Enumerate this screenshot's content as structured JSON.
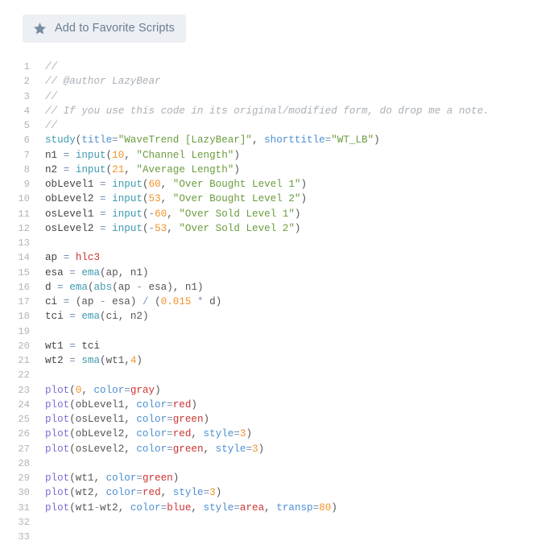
{
  "toolbar": {
    "favorite_button_label": "Add to Favorite Scripts",
    "favorite_icon": "star-icon"
  },
  "colors": {
    "button_bg": "#eceff3",
    "button_text": "#6d7d90",
    "page_bg": "#ffffff",
    "gutter_text": "#b4b4b4",
    "comment": "#a9b0b7",
    "function": "#3f9ab0",
    "plot_function": "#7b6fd4",
    "string": "#6a9c3d",
    "number": "#f0932b",
    "keyword": "#cc3333",
    "parameter": "#4b8fd1",
    "operator": "#7690b0",
    "default_text": "#444444"
  },
  "editor": {
    "first_line_number": 1,
    "last_line_number": 33,
    "language": "pine-script",
    "lines": [
      {
        "n": 1,
        "tokens": [
          {
            "t": "//",
            "c": "com"
          }
        ]
      },
      {
        "n": 2,
        "tokens": [
          {
            "t": "// @author LazyBear",
            "c": "com"
          }
        ]
      },
      {
        "n": 3,
        "tokens": [
          {
            "t": "//",
            "c": "com"
          }
        ]
      },
      {
        "n": 4,
        "tokens": [
          {
            "t": "// If you use this code in its original/modified form, do drop me a note.",
            "c": "com"
          }
        ]
      },
      {
        "n": 5,
        "tokens": [
          {
            "t": "//",
            "c": "com"
          }
        ]
      },
      {
        "n": 6,
        "tokens": [
          {
            "t": "study",
            "c": "fn"
          },
          {
            "t": "(",
            "c": "pn"
          },
          {
            "t": "title",
            "c": "param"
          },
          {
            "t": "=",
            "c": "op"
          },
          {
            "t": "\"WaveTrend [LazyBear]\"",
            "c": "str"
          },
          {
            "t": ", ",
            "c": "pn"
          },
          {
            "t": "shorttitle",
            "c": "param"
          },
          {
            "t": "=",
            "c": "op"
          },
          {
            "t": "\"WT_LB\"",
            "c": "str"
          },
          {
            "t": ")",
            "c": "pn"
          }
        ]
      },
      {
        "n": 7,
        "tokens": [
          {
            "t": "n1 ",
            "c": "var"
          },
          {
            "t": "= ",
            "c": "op"
          },
          {
            "t": "input",
            "c": "fn"
          },
          {
            "t": "(",
            "c": "pn"
          },
          {
            "t": "10",
            "c": "num"
          },
          {
            "t": ", ",
            "c": "pn"
          },
          {
            "t": "\"Channel Length\"",
            "c": "str"
          },
          {
            "t": ")",
            "c": "pn"
          }
        ]
      },
      {
        "n": 8,
        "tokens": [
          {
            "t": "n2 ",
            "c": "var"
          },
          {
            "t": "= ",
            "c": "op"
          },
          {
            "t": "input",
            "c": "fn"
          },
          {
            "t": "(",
            "c": "pn"
          },
          {
            "t": "21",
            "c": "num"
          },
          {
            "t": ", ",
            "c": "pn"
          },
          {
            "t": "\"Average Length\"",
            "c": "str"
          },
          {
            "t": ")",
            "c": "pn"
          }
        ]
      },
      {
        "n": 9,
        "tokens": [
          {
            "t": "obLevel1 ",
            "c": "var"
          },
          {
            "t": "= ",
            "c": "op"
          },
          {
            "t": "input",
            "c": "fn"
          },
          {
            "t": "(",
            "c": "pn"
          },
          {
            "t": "60",
            "c": "num"
          },
          {
            "t": ", ",
            "c": "pn"
          },
          {
            "t": "\"Over Bought Level 1\"",
            "c": "str"
          },
          {
            "t": ")",
            "c": "pn"
          }
        ]
      },
      {
        "n": 10,
        "tokens": [
          {
            "t": "obLevel2 ",
            "c": "var"
          },
          {
            "t": "= ",
            "c": "op"
          },
          {
            "t": "input",
            "c": "fn"
          },
          {
            "t": "(",
            "c": "pn"
          },
          {
            "t": "53",
            "c": "num"
          },
          {
            "t": ", ",
            "c": "pn"
          },
          {
            "t": "\"Over Bought Level 2\"",
            "c": "str"
          },
          {
            "t": ")",
            "c": "pn"
          }
        ]
      },
      {
        "n": 11,
        "tokens": [
          {
            "t": "osLevel1 ",
            "c": "var"
          },
          {
            "t": "= ",
            "c": "op"
          },
          {
            "t": "input",
            "c": "fn"
          },
          {
            "t": "(",
            "c": "pn"
          },
          {
            "t": "-",
            "c": "op"
          },
          {
            "t": "60",
            "c": "num"
          },
          {
            "t": ", ",
            "c": "pn"
          },
          {
            "t": "\"Over Sold Level 1\"",
            "c": "str"
          },
          {
            "t": ")",
            "c": "pn"
          }
        ]
      },
      {
        "n": 12,
        "tokens": [
          {
            "t": "osLevel2 ",
            "c": "var"
          },
          {
            "t": "= ",
            "c": "op"
          },
          {
            "t": "input",
            "c": "fn"
          },
          {
            "t": "(",
            "c": "pn"
          },
          {
            "t": "-",
            "c": "op"
          },
          {
            "t": "53",
            "c": "num"
          },
          {
            "t": ", ",
            "c": "pn"
          },
          {
            "t": "\"Over Sold Level 2\"",
            "c": "str"
          },
          {
            "t": ")",
            "c": "pn"
          }
        ]
      },
      {
        "n": 13,
        "tokens": []
      },
      {
        "n": 14,
        "tokens": [
          {
            "t": "ap ",
            "c": "var"
          },
          {
            "t": "= ",
            "c": "op"
          },
          {
            "t": "hlc3",
            "c": "kw"
          }
        ]
      },
      {
        "n": 15,
        "tokens": [
          {
            "t": "esa ",
            "c": "var"
          },
          {
            "t": "= ",
            "c": "op"
          },
          {
            "t": "ema",
            "c": "fn"
          },
          {
            "t": "(ap, n1)",
            "c": "pn"
          }
        ]
      },
      {
        "n": 16,
        "tokens": [
          {
            "t": "d ",
            "c": "var"
          },
          {
            "t": "= ",
            "c": "op"
          },
          {
            "t": "ema",
            "c": "fn"
          },
          {
            "t": "(",
            "c": "pn"
          },
          {
            "t": "abs",
            "c": "fn"
          },
          {
            "t": "(ap ",
            "c": "pn"
          },
          {
            "t": "- ",
            "c": "op"
          },
          {
            "t": "esa), n1)",
            "c": "pn"
          }
        ]
      },
      {
        "n": 17,
        "tokens": [
          {
            "t": "ci ",
            "c": "var"
          },
          {
            "t": "= ",
            "c": "op"
          },
          {
            "t": "(ap ",
            "c": "pn"
          },
          {
            "t": "- ",
            "c": "op"
          },
          {
            "t": "esa) ",
            "c": "pn"
          },
          {
            "t": "/ ",
            "c": "op"
          },
          {
            "t": "(",
            "c": "pn"
          },
          {
            "t": "0.015",
            "c": "num"
          },
          {
            "t": " * ",
            "c": "op"
          },
          {
            "t": "d)",
            "c": "pn"
          }
        ]
      },
      {
        "n": 18,
        "tokens": [
          {
            "t": "tci ",
            "c": "var"
          },
          {
            "t": "= ",
            "c": "op"
          },
          {
            "t": "ema",
            "c": "fn"
          },
          {
            "t": "(ci, n2)",
            "c": "pn"
          }
        ]
      },
      {
        "n": 19,
        "tokens": []
      },
      {
        "n": 20,
        "tokens": [
          {
            "t": "wt1 ",
            "c": "var"
          },
          {
            "t": "= ",
            "c": "op"
          },
          {
            "t": "tci",
            "c": "var"
          }
        ]
      },
      {
        "n": 21,
        "tokens": [
          {
            "t": "wt2 ",
            "c": "var"
          },
          {
            "t": "= ",
            "c": "op"
          },
          {
            "t": "sma",
            "c": "fn"
          },
          {
            "t": "(wt1,",
            "c": "pn"
          },
          {
            "t": "4",
            "c": "num"
          },
          {
            "t": ")",
            "c": "pn"
          }
        ]
      },
      {
        "n": 22,
        "tokens": []
      },
      {
        "n": 23,
        "tokens": [
          {
            "t": "plot",
            "c": "plot"
          },
          {
            "t": "(",
            "c": "pn"
          },
          {
            "t": "0",
            "c": "num"
          },
          {
            "t": ", ",
            "c": "pn"
          },
          {
            "t": "color",
            "c": "param"
          },
          {
            "t": "=",
            "c": "op"
          },
          {
            "t": "gray",
            "c": "kw"
          },
          {
            "t": ")",
            "c": "pn"
          }
        ]
      },
      {
        "n": 24,
        "tokens": [
          {
            "t": "plot",
            "c": "plot"
          },
          {
            "t": "(obLevel1, ",
            "c": "pn"
          },
          {
            "t": "color",
            "c": "param"
          },
          {
            "t": "=",
            "c": "op"
          },
          {
            "t": "red",
            "c": "kw"
          },
          {
            "t": ")",
            "c": "pn"
          }
        ]
      },
      {
        "n": 25,
        "tokens": [
          {
            "t": "plot",
            "c": "plot"
          },
          {
            "t": "(osLevel1, ",
            "c": "pn"
          },
          {
            "t": "color",
            "c": "param"
          },
          {
            "t": "=",
            "c": "op"
          },
          {
            "t": "green",
            "c": "kw"
          },
          {
            "t": ")",
            "c": "pn"
          }
        ]
      },
      {
        "n": 26,
        "tokens": [
          {
            "t": "plot",
            "c": "plot"
          },
          {
            "t": "(obLevel2, ",
            "c": "pn"
          },
          {
            "t": "color",
            "c": "param"
          },
          {
            "t": "=",
            "c": "op"
          },
          {
            "t": "red",
            "c": "kw"
          },
          {
            "t": ", ",
            "c": "pn"
          },
          {
            "t": "style",
            "c": "param"
          },
          {
            "t": "=",
            "c": "op"
          },
          {
            "t": "3",
            "c": "num"
          },
          {
            "t": ")",
            "c": "pn"
          }
        ]
      },
      {
        "n": 27,
        "tokens": [
          {
            "t": "plot",
            "c": "plot"
          },
          {
            "t": "(osLevel2, ",
            "c": "pn"
          },
          {
            "t": "color",
            "c": "param"
          },
          {
            "t": "=",
            "c": "op"
          },
          {
            "t": "green",
            "c": "kw"
          },
          {
            "t": ", ",
            "c": "pn"
          },
          {
            "t": "style",
            "c": "param"
          },
          {
            "t": "=",
            "c": "op"
          },
          {
            "t": "3",
            "c": "num"
          },
          {
            "t": ")",
            "c": "pn"
          }
        ]
      },
      {
        "n": 28,
        "tokens": []
      },
      {
        "n": 29,
        "tokens": [
          {
            "t": "plot",
            "c": "plot"
          },
          {
            "t": "(wt1, ",
            "c": "pn"
          },
          {
            "t": "color",
            "c": "param"
          },
          {
            "t": "=",
            "c": "op"
          },
          {
            "t": "green",
            "c": "kw"
          },
          {
            "t": ")",
            "c": "pn"
          }
        ]
      },
      {
        "n": 30,
        "tokens": [
          {
            "t": "plot",
            "c": "plot"
          },
          {
            "t": "(wt2, ",
            "c": "pn"
          },
          {
            "t": "color",
            "c": "param"
          },
          {
            "t": "=",
            "c": "op"
          },
          {
            "t": "red",
            "c": "kw"
          },
          {
            "t": ", ",
            "c": "pn"
          },
          {
            "t": "style",
            "c": "param"
          },
          {
            "t": "=",
            "c": "op"
          },
          {
            "t": "3",
            "c": "num"
          },
          {
            "t": ")",
            "c": "pn"
          }
        ]
      },
      {
        "n": 31,
        "tokens": [
          {
            "t": "plot",
            "c": "plot"
          },
          {
            "t": "(wt1",
            "c": "pn"
          },
          {
            "t": "-",
            "c": "op"
          },
          {
            "t": "wt2, ",
            "c": "pn"
          },
          {
            "t": "color",
            "c": "param"
          },
          {
            "t": "=",
            "c": "op"
          },
          {
            "t": "blue",
            "c": "kw"
          },
          {
            "t": ", ",
            "c": "pn"
          },
          {
            "t": "style",
            "c": "param"
          },
          {
            "t": "=",
            "c": "op"
          },
          {
            "t": "area",
            "c": "kw"
          },
          {
            "t": ", ",
            "c": "pn"
          },
          {
            "t": "transp",
            "c": "param"
          },
          {
            "t": "=",
            "c": "op"
          },
          {
            "t": "80",
            "c": "num"
          },
          {
            "t": ")",
            "c": "pn"
          }
        ]
      },
      {
        "n": 32,
        "tokens": []
      },
      {
        "n": 33,
        "tokens": []
      }
    ]
  }
}
